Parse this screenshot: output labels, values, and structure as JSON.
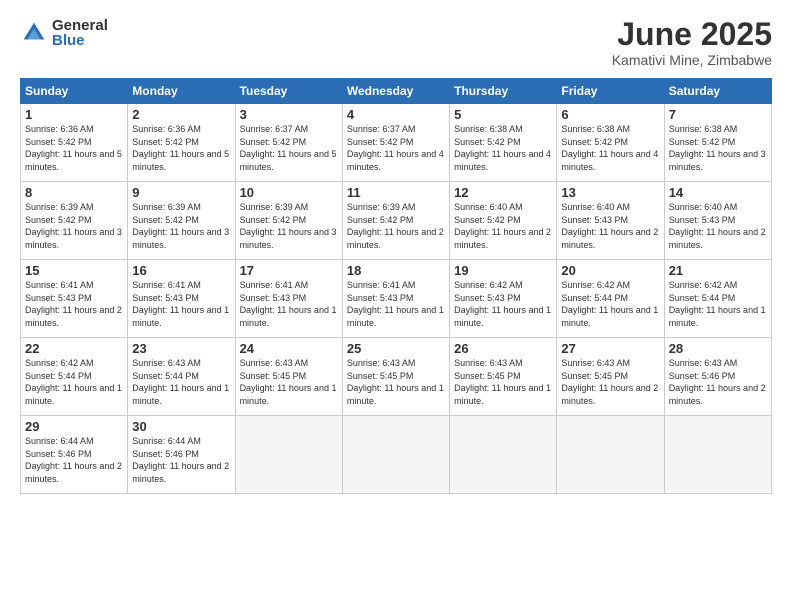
{
  "logo": {
    "general": "General",
    "blue": "Blue"
  },
  "title": "June 2025",
  "location": "Kamativi Mine, Zimbabwe",
  "days_header": [
    "Sunday",
    "Monday",
    "Tuesday",
    "Wednesday",
    "Thursday",
    "Friday",
    "Saturday"
  ],
  "weeks": [
    [
      {
        "day": "1",
        "sunrise": "6:36 AM",
        "sunset": "5:42 PM",
        "daylight": "11 hours and 5 minutes."
      },
      {
        "day": "2",
        "sunrise": "6:36 AM",
        "sunset": "5:42 PM",
        "daylight": "11 hours and 5 minutes."
      },
      {
        "day": "3",
        "sunrise": "6:37 AM",
        "sunset": "5:42 PM",
        "daylight": "11 hours and 5 minutes."
      },
      {
        "day": "4",
        "sunrise": "6:37 AM",
        "sunset": "5:42 PM",
        "daylight": "11 hours and 4 minutes."
      },
      {
        "day": "5",
        "sunrise": "6:38 AM",
        "sunset": "5:42 PM",
        "daylight": "11 hours and 4 minutes."
      },
      {
        "day": "6",
        "sunrise": "6:38 AM",
        "sunset": "5:42 PM",
        "daylight": "11 hours and 4 minutes."
      },
      {
        "day": "7",
        "sunrise": "6:38 AM",
        "sunset": "5:42 PM",
        "daylight": "11 hours and 3 minutes."
      }
    ],
    [
      {
        "day": "8",
        "sunrise": "6:39 AM",
        "sunset": "5:42 PM",
        "daylight": "11 hours and 3 minutes."
      },
      {
        "day": "9",
        "sunrise": "6:39 AM",
        "sunset": "5:42 PM",
        "daylight": "11 hours and 3 minutes."
      },
      {
        "day": "10",
        "sunrise": "6:39 AM",
        "sunset": "5:42 PM",
        "daylight": "11 hours and 3 minutes."
      },
      {
        "day": "11",
        "sunrise": "6:39 AM",
        "sunset": "5:42 PM",
        "daylight": "11 hours and 2 minutes."
      },
      {
        "day": "12",
        "sunrise": "6:40 AM",
        "sunset": "5:42 PM",
        "daylight": "11 hours and 2 minutes."
      },
      {
        "day": "13",
        "sunrise": "6:40 AM",
        "sunset": "5:43 PM",
        "daylight": "11 hours and 2 minutes."
      },
      {
        "day": "14",
        "sunrise": "6:40 AM",
        "sunset": "5:43 PM",
        "daylight": "11 hours and 2 minutes."
      }
    ],
    [
      {
        "day": "15",
        "sunrise": "6:41 AM",
        "sunset": "5:43 PM",
        "daylight": "11 hours and 2 minutes."
      },
      {
        "day": "16",
        "sunrise": "6:41 AM",
        "sunset": "5:43 PM",
        "daylight": "11 hours and 1 minute."
      },
      {
        "day": "17",
        "sunrise": "6:41 AM",
        "sunset": "5:43 PM",
        "daylight": "11 hours and 1 minute."
      },
      {
        "day": "18",
        "sunrise": "6:41 AM",
        "sunset": "5:43 PM",
        "daylight": "11 hours and 1 minute."
      },
      {
        "day": "19",
        "sunrise": "6:42 AM",
        "sunset": "5:43 PM",
        "daylight": "11 hours and 1 minute."
      },
      {
        "day": "20",
        "sunrise": "6:42 AM",
        "sunset": "5:44 PM",
        "daylight": "11 hours and 1 minute."
      },
      {
        "day": "21",
        "sunrise": "6:42 AM",
        "sunset": "5:44 PM",
        "daylight": "11 hours and 1 minute."
      }
    ],
    [
      {
        "day": "22",
        "sunrise": "6:42 AM",
        "sunset": "5:44 PM",
        "daylight": "11 hours and 1 minute."
      },
      {
        "day": "23",
        "sunrise": "6:43 AM",
        "sunset": "5:44 PM",
        "daylight": "11 hours and 1 minute."
      },
      {
        "day": "24",
        "sunrise": "6:43 AM",
        "sunset": "5:45 PM",
        "daylight": "11 hours and 1 minute."
      },
      {
        "day": "25",
        "sunrise": "6:43 AM",
        "sunset": "5:45 PM",
        "daylight": "11 hours and 1 minute."
      },
      {
        "day": "26",
        "sunrise": "6:43 AM",
        "sunset": "5:45 PM",
        "daylight": "11 hours and 1 minute."
      },
      {
        "day": "27",
        "sunrise": "6:43 AM",
        "sunset": "5:45 PM",
        "daylight": "11 hours and 2 minutes."
      },
      {
        "day": "28",
        "sunrise": "6:43 AM",
        "sunset": "5:46 PM",
        "daylight": "11 hours and 2 minutes."
      }
    ],
    [
      {
        "day": "29",
        "sunrise": "6:44 AM",
        "sunset": "5:46 PM",
        "daylight": "11 hours and 2 minutes."
      },
      {
        "day": "30",
        "sunrise": "6:44 AM",
        "sunset": "5:46 PM",
        "daylight": "11 hours and 2 minutes."
      },
      null,
      null,
      null,
      null,
      null
    ]
  ]
}
